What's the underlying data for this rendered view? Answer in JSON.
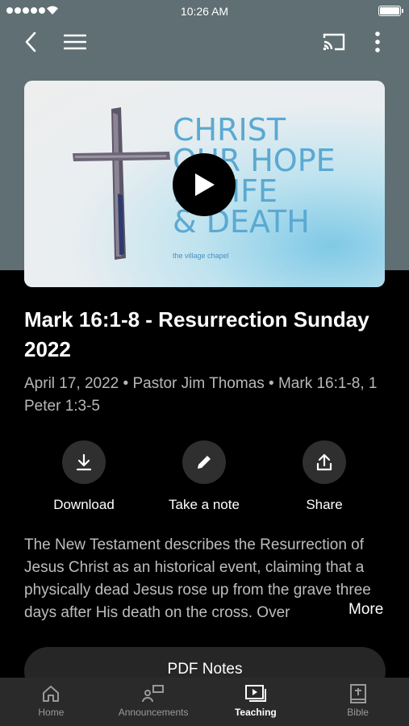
{
  "status_bar": {
    "time": "10:26 AM"
  },
  "hero": {
    "title": "CHRIST\nOUR HOPE\nIN LIFE\n& DEATH",
    "brand": "the village chapel"
  },
  "sermon": {
    "title": "Mark 16:1-8 - Resurrection Sunday 2022",
    "meta": "April 17, 2022 • Pastor Jim Thomas • Mark 16:1-8, 1 Peter 1:3-5",
    "description": "The New Testament describes the Resurrection of Jesus Christ as an historical event, claiming that a physically dead Jesus rose up from the grave three days after His death on the cross. Over",
    "more_label": "More"
  },
  "actions": {
    "download": "Download",
    "note": "Take a note",
    "share": "Share"
  },
  "pdf_button": "PDF Notes",
  "tabs": [
    {
      "label": "Home",
      "icon": "home-icon",
      "active": false
    },
    {
      "label": "Announcements",
      "icon": "announcements-icon",
      "active": false
    },
    {
      "label": "Teaching",
      "icon": "teaching-icon",
      "active": true
    },
    {
      "label": "Bible",
      "icon": "bible-icon",
      "active": false
    }
  ],
  "colors": {
    "header": "#5f6f73",
    "background": "#000000",
    "tabbar": "#2a2a2a",
    "hero_text": "#5aa9d2"
  }
}
